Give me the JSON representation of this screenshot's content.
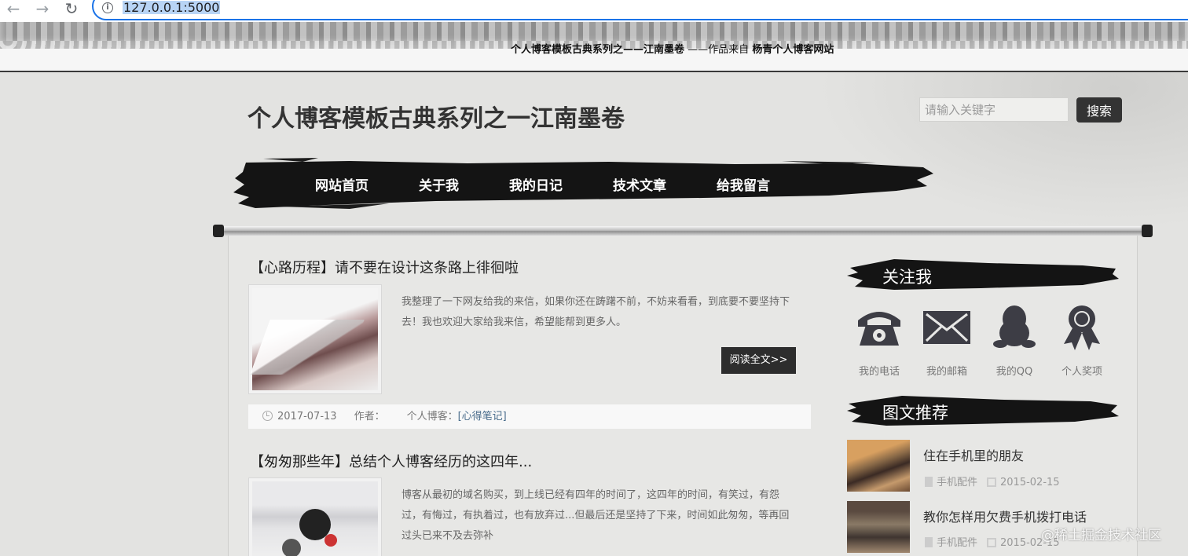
{
  "browser": {
    "url": "127.0.0.1:5000",
    "back_icon": "arrow-left-icon",
    "forward_icon": "arrow-right-icon",
    "reload_icon": "reload-icon",
    "info_icon": "info-icon"
  },
  "banner": {
    "credit_title": "个人博客模板古典系列之——江南墨卷",
    "credit_from": "——作品来自",
    "credit_site": "杨青个人博客网站"
  },
  "header": {
    "site_title": "个人博客模板古典系列之一江南墨卷",
    "search_placeholder": "请输入关键字",
    "search_button": "搜索"
  },
  "nav": {
    "items": [
      "网站首页",
      "关于我",
      "我的日记",
      "技术文章",
      "给我留言"
    ]
  },
  "articles": [
    {
      "title": "【心路历程】请不要在设计这条路上徘徊啦",
      "excerpt": "我整理了一下网友给我的来信，如果你还在踌躇不前，不妨来看看，到底要不要坚持下去！我也欢迎大家给我来信，希望能帮到更多人。",
      "read_more": "阅读全文>>",
      "date": "2017-07-13",
      "author_label": "作者：",
      "category_label": "个人博客：",
      "category": "[心得笔记]"
    },
    {
      "title": "【匆匆那些年】总结个人博客经历的这四年...",
      "excerpt": "博客从最初的域名购买，到上线已经有四年的时间了，这四年的时间，有笑过，有怨过，有悔过，有执着过，也有放弃过...但最后还是坚持了下来，时间如此匆匆，等再回过头已来不及去弥补"
    }
  ],
  "sidebar": {
    "follow_heading": "关注我",
    "contacts": [
      {
        "label": "我的电话",
        "icon": "phone-icon"
      },
      {
        "label": "我的邮箱",
        "icon": "mail-icon"
      },
      {
        "label": "我的QQ",
        "icon": "qq-penguin-icon"
      },
      {
        "label": "个人奖项",
        "icon": "award-ribbon-icon"
      }
    ],
    "recommend_heading": "图文推荐",
    "recommend": [
      {
        "title": "住在手机里的朋友",
        "category": "手机配件",
        "date": "2015-02-15"
      },
      {
        "title": "教你怎样用欠费手机拨打电话",
        "category": "手机配件",
        "date": "2015-02-15"
      }
    ]
  },
  "watermark": "@稀土掘金技术社区",
  "colors": {
    "background": "#e3e3e1",
    "ink": "#111111",
    "button": "#2d2d2d",
    "link": "#4a6d8c",
    "browser_focus": "#1a73e8"
  }
}
